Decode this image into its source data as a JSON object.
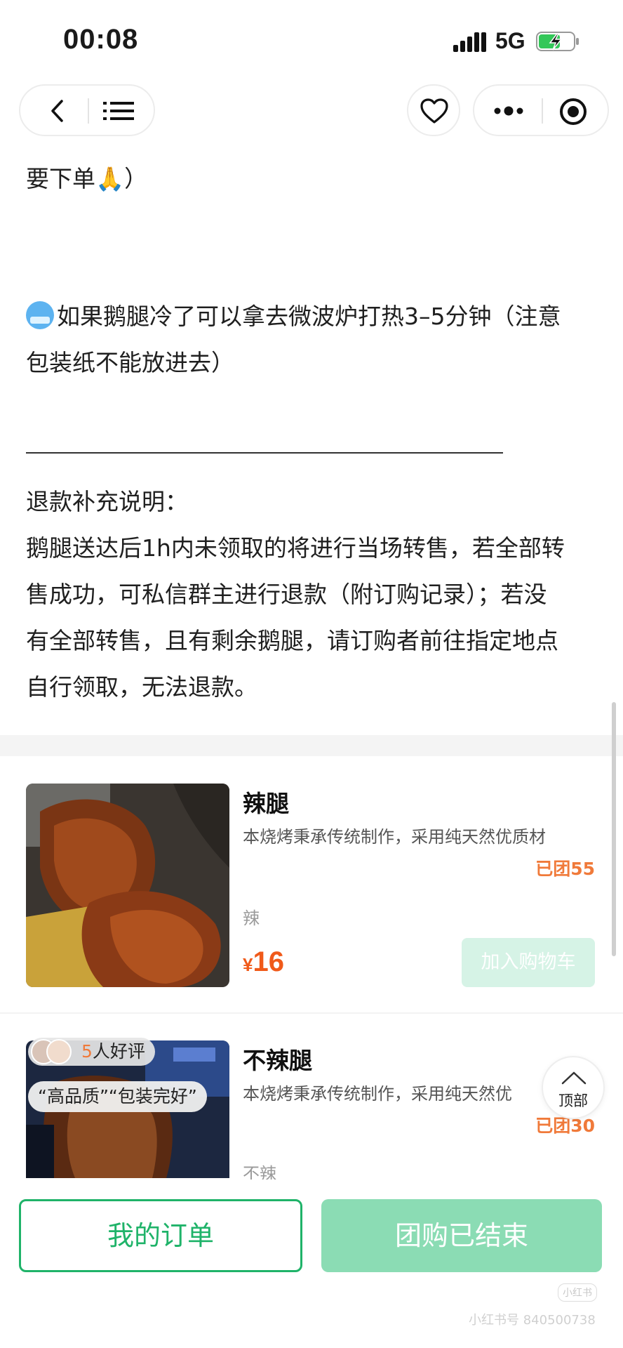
{
  "status_bar": {
    "time": "00:08",
    "network": "5G"
  },
  "article": {
    "line1": "要下单🙏）",
    "note_line1": "如果鹅腿冷了可以拿去微波炉打热3–5分钟（注意",
    "note_line2": "包装纸不能放进去）",
    "refund_title": "退款补充说明：",
    "refund_lines": [
      "鹅腿送达后1h内未领取的将进行当场转售，若全部转",
      "售成功，可私信群主进行退款（附订购记录）；若没",
      "有全部转售，且有剩余鹅腿，请订购者前往指定地点",
      "自行领取，无法退款。"
    ]
  },
  "products": [
    {
      "name": "辣腿",
      "desc": "本烧烤秉承传统制作，采用纯天然优质材",
      "sold": "已团55",
      "spec": "辣",
      "price_symbol": "¥",
      "price": "16",
      "cart_label": "加入购物车"
    },
    {
      "name": "不辣腿",
      "desc": "本烧烤秉承传统制作，采用纯天然优",
      "sold": "已团30",
      "spec": "不辣",
      "review_count": "5",
      "review_suffix": "人好评",
      "review_quote": "“高品质”“包装完好”"
    }
  ],
  "top_button": {
    "label": "顶部"
  },
  "bottom_bar": {
    "orders_label": "我的订单",
    "status_label": "团购已结束"
  },
  "watermark": {
    "logo": "小红书",
    "id": "小红书号 840500738"
  },
  "colors": {
    "green": "#1fb369",
    "green_light": "#8bdcb4",
    "orange": "#f07a3a",
    "price": "#f05a1a"
  }
}
